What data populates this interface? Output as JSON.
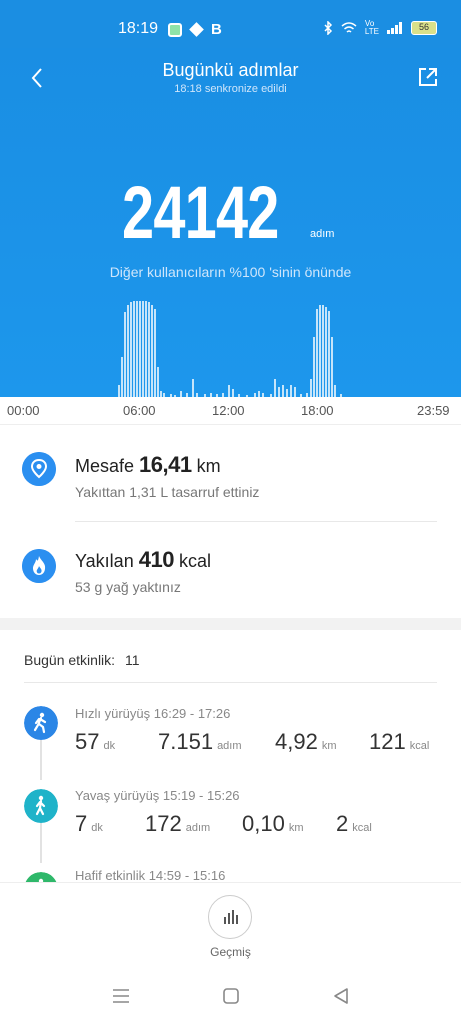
{
  "status": {
    "time": "18:19",
    "battery": "56"
  },
  "header": {
    "title": "Bugünkü adımlar",
    "sync": "18:18 senkronize edildi"
  },
  "summary": {
    "steps": "24142",
    "steps_unit": "adım",
    "rank": "Diğer kullanıcıların %100 'sinin önünde"
  },
  "axis": {
    "t0": "00:00",
    "t1": "06:00",
    "t2": "12:00",
    "t3": "18:00",
    "t4": "23:59"
  },
  "distance": {
    "label": "Mesafe",
    "value": "16,41",
    "unit": "km",
    "sub": "Yakıttan 1,31 L tasarruf ettiniz"
  },
  "calories": {
    "label": "Yakılan",
    "value": "410",
    "unit": "kcal",
    "sub": "53 g yağ yaktınız"
  },
  "activity": {
    "title": "Bugün etkinlik:",
    "count": "11",
    "items": [
      {
        "name": "Hızlı yürüyüş 16:29 - 17:26",
        "dur": "57",
        "dur_u": "dk",
        "steps": "7.151",
        "steps_u": "adım",
        "dist": "4,92",
        "dist_u": "km",
        "kcal": "121",
        "kcal_u": "kcal",
        "color": "#2b86e6"
      },
      {
        "name": "Yavaş yürüyüş 15:19 - 15:26",
        "dur": "7",
        "dur_u": "dk",
        "steps": "172",
        "steps_u": "adım",
        "dist": "0,10",
        "dist_u": "km",
        "kcal": "2",
        "kcal_u": "kcal",
        "color": "#1fb3c9"
      },
      {
        "name": "Hafif etkinlik 14:59 - 15:16",
        "color": "#2fb86a"
      }
    ]
  },
  "bottom": {
    "history_label": "Geçmiş"
  }
}
